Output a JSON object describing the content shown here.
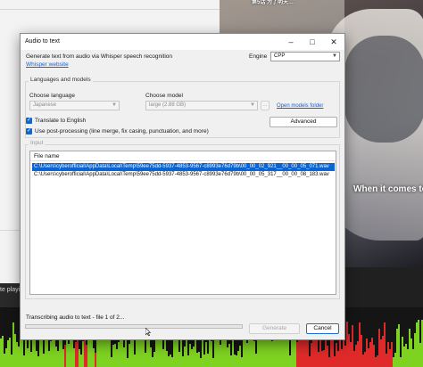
{
  "background": {
    "subtitle": "When it comes to",
    "video_top_text": "第5话 为了明天…",
    "player_label": "te playing",
    "wave_colors": {
      "green": "#7ed321",
      "red": "#e02a2a"
    }
  },
  "dialog": {
    "title": "Audio to text",
    "description": "Generate text from audio via Whisper speech recognition",
    "whisper_link": "Whisper website",
    "engine_label": "Engine",
    "engine_value": "CPP",
    "languages_group": "Languages and models",
    "language_label": "Choose language",
    "language_value": "Japanese",
    "model_label": "Choose model",
    "model_value": "large (2.88 GB)",
    "model_browse_label": "...",
    "open_models_folder": "Open models folder",
    "advanced_button": "Advanced",
    "translate_label": "Translate to English",
    "translate_checked": true,
    "postprocess_label": "Use post-processing (line merge, fix casing, punctuation, and more)",
    "postprocess_checked": true,
    "input_group": "Input",
    "file_list": {
      "column": "File name",
      "rows": [
        "C:\\Users\\cyberofficial\\AppData\\Local\\Temp\\59ee75dd-5937-4853-9567-c8993e76d79b\\00_00_02_921__00_00_05_071.wav",
        "C:\\Users\\cyberofficial\\AppData\\Local\\Temp\\59ee75dd-5937-4853-9567-c8993e76d79b\\00_00_05_317__00_00_08_183.wav"
      ],
      "selected_index": 0
    },
    "status_text": "Transcribing audio to text - file 1 of 2...",
    "progress_fraction": 0.0,
    "generate_button": "Generate",
    "cancel_button": "Cancel"
  }
}
